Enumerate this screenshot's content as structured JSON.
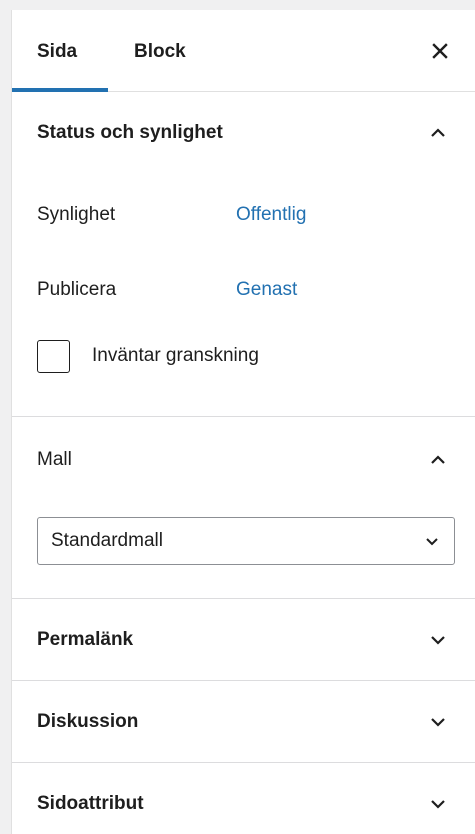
{
  "tabs": {
    "page_label": "Sida",
    "block_label": "Block"
  },
  "status_section": {
    "title": "Status och synlighet",
    "visibility_label": "Synlighet",
    "visibility_value": "Offentlig",
    "publish_label": "Publicera",
    "publish_value": "Genast",
    "pending_review_label": "Inväntar granskning",
    "pending_review_checked": false
  },
  "template_section": {
    "title": "Mall",
    "selected_template": "Standardmall"
  },
  "collapsed_sections": {
    "permalink": "Permalänk",
    "discussion": "Diskussion",
    "page_attributes": "Sidoattribut"
  },
  "colors": {
    "accent": "#2271b1",
    "text": "#1e1e1e",
    "border": "#e0e0e0"
  }
}
